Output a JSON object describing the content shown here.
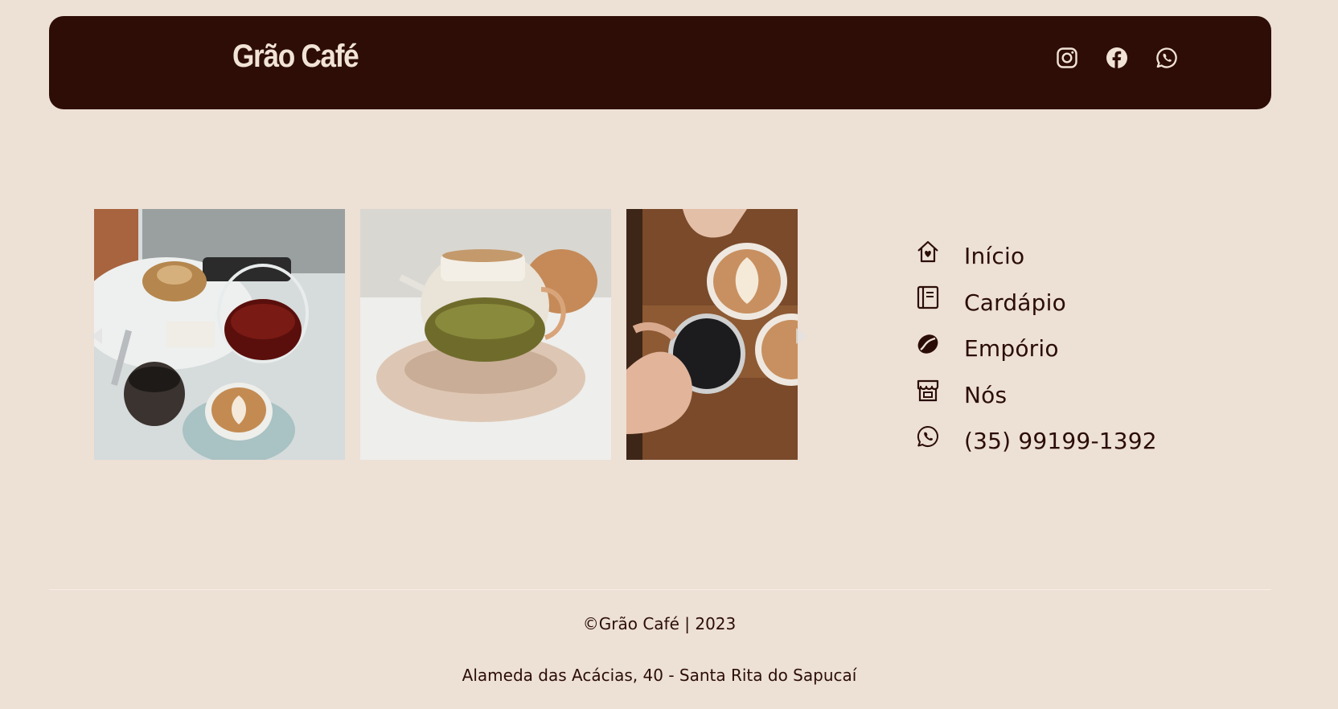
{
  "header": {
    "brand": "Grão Café",
    "social": [
      {
        "icon": "instagram-icon"
      },
      {
        "icon": "facebook-icon"
      },
      {
        "icon": "whatsapp-icon"
      }
    ]
  },
  "carousel": {
    "photos": [
      {
        "subject": "latte-and-carafe-photo"
      },
      {
        "subject": "teapot-photo"
      },
      {
        "subject": "cappuccino-toast-photo"
      }
    ]
  },
  "nav": {
    "items": [
      {
        "label": "Início",
        "icon": "home-heart-icon"
      },
      {
        "label": "Cardápio",
        "icon": "menu-book-icon"
      },
      {
        "label": "Empório",
        "icon": "coffee-bean-icon"
      },
      {
        "label": "Nós",
        "icon": "store-icon"
      },
      {
        "label": "(35) 99199-1392",
        "icon": "whatsapp-icon"
      }
    ]
  },
  "footer": {
    "copyright": "©Grão Café | 2023",
    "address": "Alameda das Acácias, 40 - Santa Rita do Sapucaí"
  },
  "colors": {
    "background": "#ede0d5",
    "header_bg": "#2e0d07",
    "header_text": "#f1e3d6",
    "text": "#2b0d08"
  }
}
